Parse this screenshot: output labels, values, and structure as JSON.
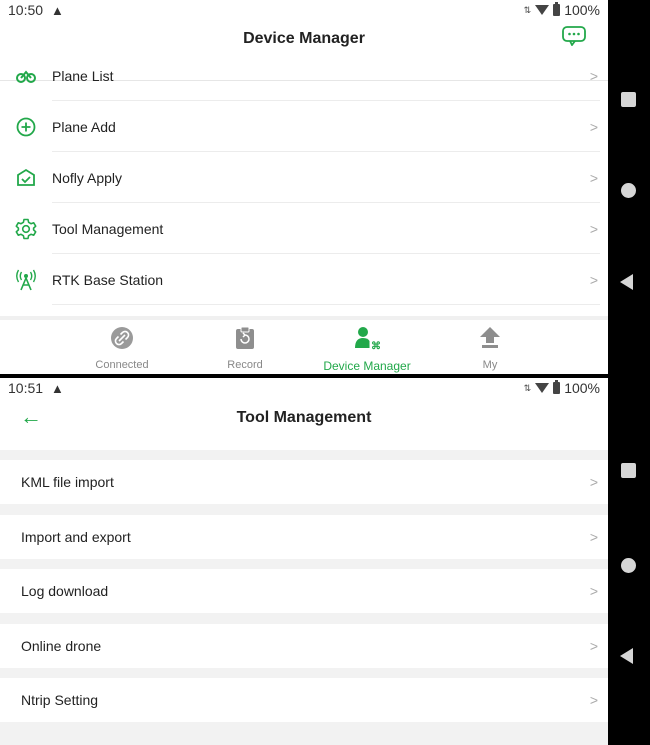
{
  "screen1": {
    "status": {
      "time": "10:50",
      "warning": "▲",
      "battery": "100%"
    },
    "header": {
      "title": "Device Manager",
      "chat_icon": "chat-bubble-icon"
    },
    "menu": [
      {
        "label": "Plane List",
        "icon": "drone-icon"
      },
      {
        "label": "Plane Add",
        "icon": "plus-circle-icon"
      },
      {
        "label": "Nofly Apply",
        "icon": "shield-check-icon"
      },
      {
        "label": "Tool Management",
        "icon": "gear-icon"
      },
      {
        "label": "RTK Base Station",
        "icon": "antenna-icon"
      }
    ],
    "chevron": ">",
    "tabs": [
      {
        "label": "Connected",
        "icon": "link-icon",
        "active": false
      },
      {
        "label": "Record",
        "icon": "clipboard-icon",
        "active": false
      },
      {
        "label": "Device Manager",
        "icon": "user-device-icon",
        "active": true
      },
      {
        "label": "My",
        "icon": "upload-icon",
        "active": false
      }
    ]
  },
  "screen2": {
    "status": {
      "time": "10:51",
      "warning": "▲",
      "battery": "100%"
    },
    "header": {
      "title": "Tool Management",
      "back": "←"
    },
    "menu": [
      {
        "label": "KML file import"
      },
      {
        "label": "Import and export"
      },
      {
        "label": "Log download"
      },
      {
        "label": "Online drone"
      },
      {
        "label": "Ntrip Setting"
      }
    ],
    "chevron": ">"
  },
  "colors": {
    "accent": "#22a84a",
    "tab_inactive": "#888888"
  }
}
